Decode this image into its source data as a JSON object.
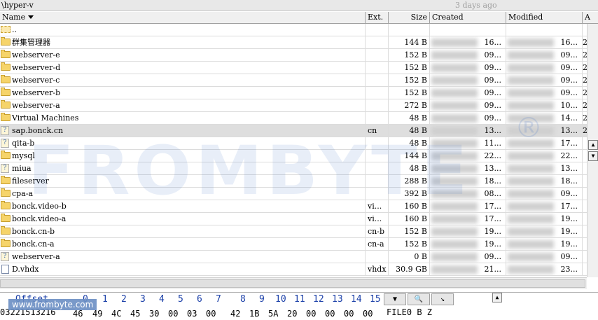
{
  "path_bar": {
    "path": "\\hyper-v",
    "age": "3 days ago"
  },
  "columns": {
    "name": "Name",
    "ext": "Ext.",
    "size": "Size",
    "created": "Created",
    "modified": "Modified",
    "attr": "A"
  },
  "rows": [
    {
      "icon": "parent-folder-icon",
      "name": "..",
      "ext": "",
      "size": "",
      "created": "",
      "modified": "",
      "attr": ""
    },
    {
      "icon": "folder-icon",
      "name": "群集管理器",
      "ext": "",
      "size": "144 B",
      "created": "16...",
      "modified": "16...",
      "attr": "2"
    },
    {
      "icon": "folder-icon",
      "name": "webserver-e",
      "ext": "",
      "size": "152 B",
      "created": "09...",
      "modified": "09...",
      "attr": "2"
    },
    {
      "icon": "folder-icon",
      "name": "webserver-d",
      "ext": "",
      "size": "152 B",
      "created": "09...",
      "modified": "09...",
      "attr": "2"
    },
    {
      "icon": "folder-icon",
      "name": "webserver-c",
      "ext": "",
      "size": "152 B",
      "created": "09...",
      "modified": "09...",
      "attr": "2"
    },
    {
      "icon": "folder-icon",
      "name": "webserver-b",
      "ext": "",
      "size": "152 B",
      "created": "09...",
      "modified": "09...",
      "attr": "2"
    },
    {
      "icon": "folder-icon",
      "name": "webserver-a",
      "ext": "",
      "size": "272 B",
      "created": "09...",
      "modified": "10...",
      "attr": "2"
    },
    {
      "icon": "folder-icon",
      "name": "Virtual Machines",
      "ext": "",
      "size": "48 B",
      "created": "09...",
      "modified": "14...",
      "attr": "2"
    },
    {
      "icon": "unknown-file-icon",
      "name": "sap.bonck.cn",
      "ext": "cn",
      "size": "48 B",
      "created": "13...",
      "modified": "13...",
      "attr": "2",
      "selected": true
    },
    {
      "icon": "unknown-file-icon",
      "name": "qita-b",
      "ext": "",
      "size": "48 B",
      "created": "11...",
      "modified": "17...",
      "attr": ""
    },
    {
      "icon": "folder-icon",
      "name": "mysql",
      "ext": "",
      "size": "144 B",
      "created": "22...",
      "modified": "22...",
      "attr": ""
    },
    {
      "icon": "unknown-file-icon",
      "name": "miua",
      "ext": "",
      "size": "48 B",
      "created": "13...",
      "modified": "13...",
      "attr": ""
    },
    {
      "icon": "folder-icon",
      "name": "fileserver",
      "ext": "",
      "size": "288 B",
      "created": "18...",
      "modified": "18...",
      "attr": ""
    },
    {
      "icon": "folder-icon",
      "name": "cpa-a",
      "ext": "",
      "size": "392 B",
      "created": "08...",
      "modified": "09...",
      "attr": ""
    },
    {
      "icon": "folder-icon",
      "name": "bonck.video-b",
      "ext": "vi...",
      "size": "160 B",
      "created": "17...",
      "modified": "17...",
      "attr": ""
    },
    {
      "icon": "folder-icon",
      "name": "bonck.video-a",
      "ext": "vi...",
      "size": "160 B",
      "created": "17...",
      "modified": "19...",
      "attr": ""
    },
    {
      "icon": "folder-icon",
      "name": "bonck.cn-b",
      "ext": "cn-b",
      "size": "152 B",
      "created": "19...",
      "modified": "19...",
      "attr": ""
    },
    {
      "icon": "folder-icon",
      "name": "bonck.cn-a",
      "ext": "cn-a",
      "size": "152 B",
      "created": "19...",
      "modified": "19...",
      "attr": ""
    },
    {
      "icon": "unknown-file-icon",
      "name": "webserver-a",
      "ext": "",
      "size": "0 B",
      "created": "09...",
      "modified": "09...",
      "attr": ""
    },
    {
      "icon": "file-icon",
      "name": "D.vhdx",
      "ext": "vhdx",
      "size": "30.9 GB",
      "created": "21...",
      "modified": "23...",
      "attr": ""
    }
  ],
  "hex": {
    "offset_label": "Offset",
    "columns": [
      "0",
      "1",
      "2",
      "3",
      "4",
      "5",
      "6",
      "7",
      "8",
      "9",
      "10",
      "11",
      "12",
      "13",
      "14",
      "15"
    ],
    "row_offset": "03221513216",
    "bytes": [
      "46",
      "49",
      "4C",
      "45",
      "30",
      "00",
      "03",
      "00",
      "42",
      "1B",
      "5A",
      "20",
      "00",
      "00",
      "00",
      "00"
    ],
    "ascii": "FILE0   B Z"
  },
  "watermark": {
    "text": "FROMBYTE",
    "reg": "®",
    "url": "www.frombyte.com"
  },
  "colors": {
    "selected_row": "#dedede",
    "hex_header": "#1a3fa8",
    "folder": "#f6d46a"
  }
}
